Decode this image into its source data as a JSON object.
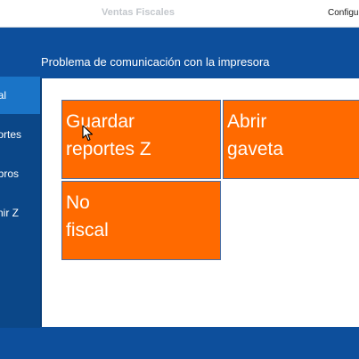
{
  "window": {
    "title": "Ventas Fiscales",
    "config_label": "Configura"
  },
  "status": {
    "message": "Problema de comunicación  con la impresora"
  },
  "sidebar": {
    "items": [
      {
        "label": "al"
      },
      {
        "label": "ortes"
      },
      {
        "label": "bros"
      },
      {
        "label": "nir Z"
      }
    ]
  },
  "tiles": [
    {
      "line1": "Guardar",
      "line2": "reportes Z"
    },
    {
      "line1": "Abrir",
      "line2": "gaveta"
    },
    {
      "line1": "No",
      "line2": "fiscal"
    }
  ],
  "colors": {
    "accent_blue": "#0d4f9c",
    "active_item": "#1a74c7",
    "tile_orange": "#ff6a00"
  }
}
